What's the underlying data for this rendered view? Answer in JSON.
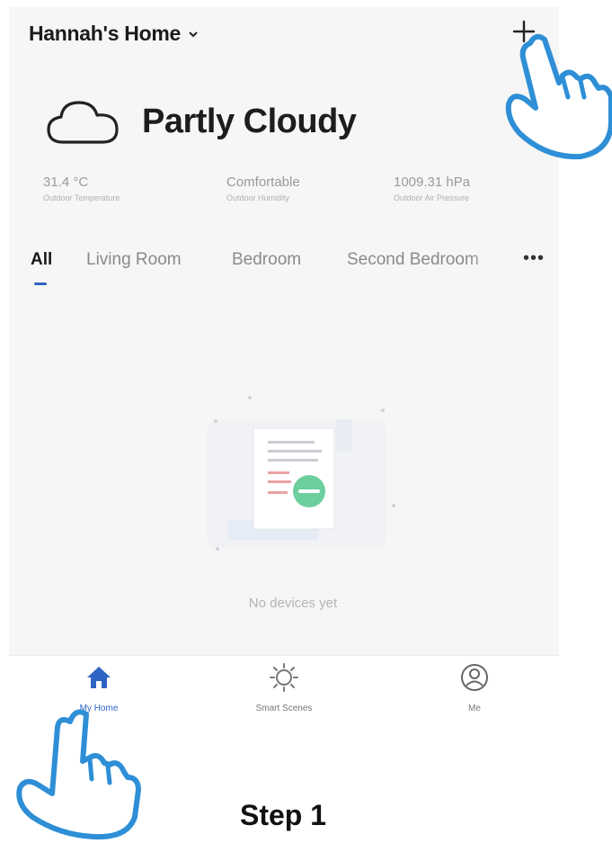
{
  "header": {
    "home_name": "Hannah's Home",
    "add_icon": "plus-icon"
  },
  "weather": {
    "icon": "cloud-icon",
    "condition": "Partly Cloudy",
    "stats": [
      {
        "value": "31.4 °C",
        "label": "Outdoor Temperature"
      },
      {
        "value": "Comfortable",
        "label": "Outdoor Humidity"
      },
      {
        "value": "1009.31 hPa",
        "label": "Outdoor Air Pressure"
      }
    ]
  },
  "tabs": {
    "items": [
      {
        "label": "All",
        "active": true
      },
      {
        "label": "Living Room",
        "active": false
      },
      {
        "label": "Bedroom",
        "active": false
      },
      {
        "label": "Second Bedroom",
        "active": false
      }
    ],
    "more_label": "•••"
  },
  "empty_state": {
    "text": "No devices yet"
  },
  "bottom_nav": {
    "items": [
      {
        "label": "My Home",
        "icon": "home-icon",
        "active": true
      },
      {
        "label": "Smart Scenes",
        "icon": "sun-icon",
        "active": false
      },
      {
        "label": "Me",
        "icon": "profile-icon",
        "active": false
      }
    ]
  },
  "caption": "Step 1",
  "colors": {
    "accent": "#2f63c4",
    "hand": "#2e8fd6",
    "empty_badge": "#6ccf9d"
  }
}
